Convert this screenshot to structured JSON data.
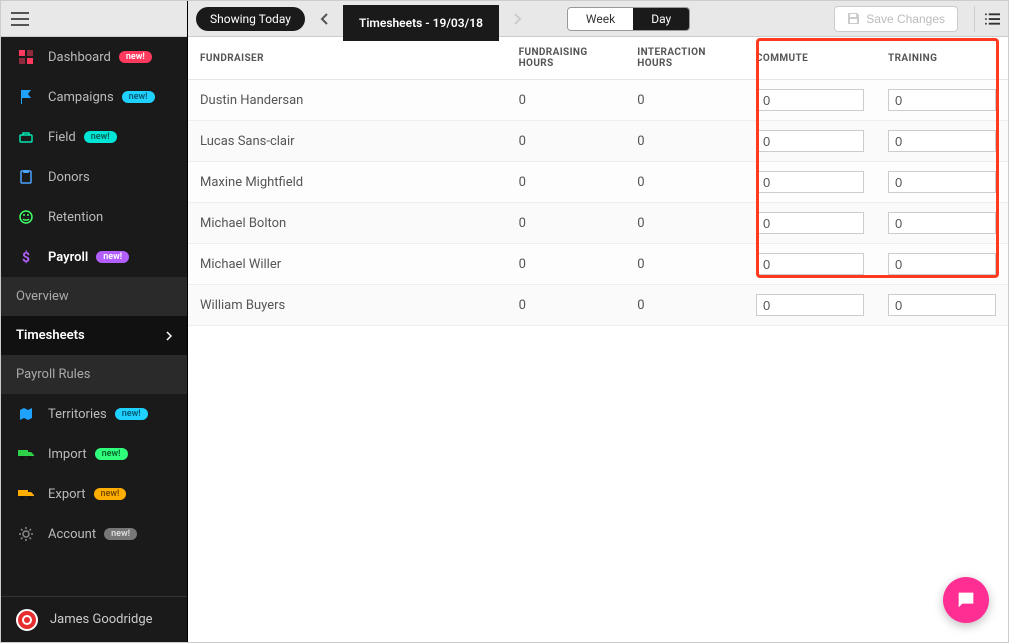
{
  "sidebar": {
    "items": [
      {
        "label": "Dashboard",
        "badge": "new!",
        "badgeClass": "badge-pink",
        "icon": "dashboard"
      },
      {
        "label": "Campaigns",
        "badge": "new!",
        "badgeClass": "badge-blue",
        "icon": "flag"
      },
      {
        "label": "Field",
        "badge": "new!",
        "badgeClass": "badge-cyan",
        "icon": "field"
      },
      {
        "label": "Donors",
        "badge": "",
        "badgeClass": "",
        "icon": "clipboard"
      },
      {
        "label": "Retention",
        "badge": "",
        "badgeClass": "",
        "icon": "smile"
      },
      {
        "label": "Payroll",
        "badge": "new!",
        "badgeClass": "badge-purple",
        "icon": "dollar",
        "active": true
      }
    ],
    "payrollSub": [
      {
        "label": "Overview"
      },
      {
        "label": "Timesheets",
        "active": true
      },
      {
        "label": "Payroll Rules"
      }
    ],
    "items2": [
      {
        "label": "Territories",
        "badge": "new!",
        "badgeClass": "badge-blue",
        "icon": "map"
      },
      {
        "label": "Import",
        "badge": "new!",
        "badgeClass": "badge-green",
        "icon": "truck-in"
      },
      {
        "label": "Export",
        "badge": "new!",
        "badgeClass": "badge-orange",
        "icon": "truck-out"
      },
      {
        "label": "Account",
        "badge": "new!",
        "badgeClass": "badge-grey",
        "icon": "gear"
      }
    ],
    "user": "James Goodridge"
  },
  "toolbar": {
    "showing": "Showing Today",
    "title": "Timesheets - 19/03/18",
    "segment": {
      "week": "Week",
      "day": "Day",
      "active": "day"
    },
    "save": "Save Changes"
  },
  "table": {
    "headers": {
      "fundraiser": "Fundraiser",
      "fundraising_hours": "Fundraising Hours",
      "interaction_hours": "Interaction Hours",
      "commute": "Commute",
      "training": "Training"
    },
    "rows": [
      {
        "name": "Dustin Handersan",
        "fh": "0",
        "ih": "0",
        "commute": "0",
        "training": "0"
      },
      {
        "name": "Lucas Sans-clair",
        "fh": "0",
        "ih": "0",
        "commute": "0",
        "training": "0"
      },
      {
        "name": "Maxine Mightfield",
        "fh": "0",
        "ih": "0",
        "commute": "0",
        "training": "0"
      },
      {
        "name": "Michael Bolton",
        "fh": "0",
        "ih": "0",
        "commute": "0",
        "training": "0"
      },
      {
        "name": "Michael Willer",
        "fh": "0",
        "ih": "0",
        "commute": "0",
        "training": "0"
      },
      {
        "name": "William Buyers",
        "fh": "0",
        "ih": "0",
        "commute": "0",
        "training": "0"
      }
    ]
  }
}
